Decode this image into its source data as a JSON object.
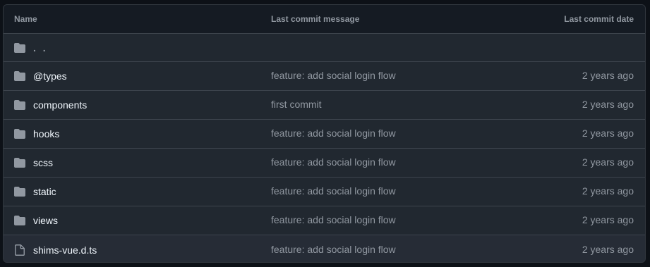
{
  "header": {
    "name": "Name",
    "message": "Last commit message",
    "date": "Last commit date"
  },
  "parent": {
    "label": ". .",
    "icon": "folder-icon"
  },
  "rows": [
    {
      "type": "folder",
      "icon": "folder-icon",
      "name": "@types",
      "message": "feature: add social login flow",
      "date": "2 years ago"
    },
    {
      "type": "folder",
      "icon": "folder-icon",
      "name": "components",
      "message": "first commit",
      "date": "2 years ago"
    },
    {
      "type": "folder",
      "icon": "folder-icon",
      "name": "hooks",
      "message": "feature: add social login flow",
      "date": "2 years ago"
    },
    {
      "type": "folder",
      "icon": "folder-icon",
      "name": "scss",
      "message": "feature: add social login flow",
      "date": "2 years ago"
    },
    {
      "type": "folder",
      "icon": "folder-icon",
      "name": "static",
      "message": "feature: add social login flow",
      "date": "2 years ago"
    },
    {
      "type": "folder",
      "icon": "folder-icon",
      "name": "views",
      "message": "feature: add social login flow",
      "date": "2 years ago"
    },
    {
      "type": "file",
      "icon": "file-icon",
      "name": "shims-vue.d.ts",
      "message": "feature: add social login flow",
      "date": "2 years ago"
    }
  ],
  "colors": {
    "background": "#212830",
    "header_background": "#151b23",
    "border": "#3d444d",
    "text_primary": "#f0f6fc",
    "text_muted": "#9198a1",
    "icon": "#9198a1"
  }
}
